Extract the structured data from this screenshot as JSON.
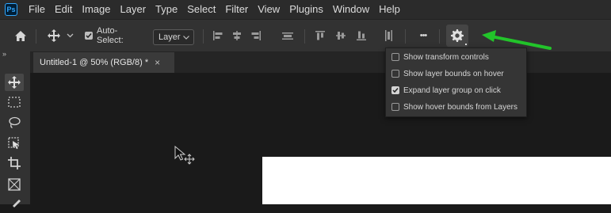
{
  "app": {
    "logo_text": "Ps"
  },
  "menu": [
    "File",
    "Edit",
    "Image",
    "Layer",
    "Type",
    "Select",
    "Filter",
    "View",
    "Plugins",
    "Window",
    "Help"
  ],
  "options_bar": {
    "auto_select_label": "Auto-Select:",
    "auto_select_checked": true,
    "layer_select_value": "Layer",
    "more_label": "•••"
  },
  "document_tab": {
    "title": "Untitled-1 @ 50% (RGB/8) *",
    "close": "×"
  },
  "dropdown": {
    "items": [
      {
        "label": "Show transform controls",
        "checked": false
      },
      {
        "label": "Show layer bounds on hover",
        "checked": false
      },
      {
        "label": "Expand layer group on click",
        "checked": true
      },
      {
        "label": "Show hover bounds from Layers",
        "checked": false
      }
    ]
  },
  "colors": {
    "accent_arrow": "#22c42a",
    "panel": "#323232",
    "menubar": "#2b2b2b",
    "canvas": "#1a1a1a"
  },
  "icons": [
    "home-icon",
    "move-tool-icon",
    "chevron-down-icon",
    "align-left-icon",
    "align-hcenter-icon",
    "align-right-icon",
    "distribute-icon",
    "align-top-icon",
    "align-vcenter-icon",
    "align-bottom-icon",
    "distribute-vertical-icon",
    "more-icon",
    "gear-icon",
    "marquee-icon",
    "lasso-icon",
    "object-select-icon",
    "crop-icon",
    "frame-icon",
    "collapse-icon"
  ]
}
